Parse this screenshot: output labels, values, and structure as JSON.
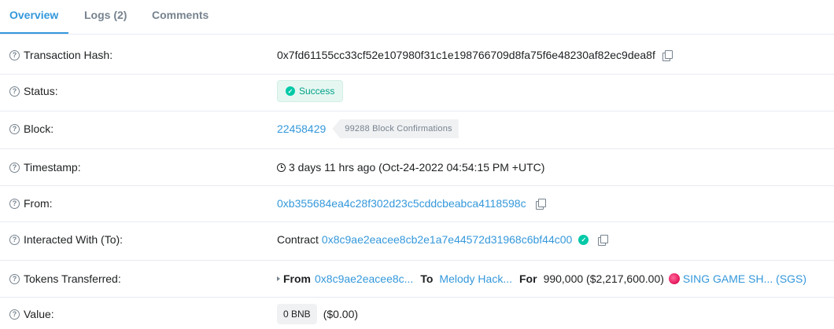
{
  "tabs": {
    "overview": "Overview",
    "logs": "Logs (2)",
    "comments": "Comments"
  },
  "help_glyph": "?",
  "rows": {
    "tx_hash": {
      "label": "Transaction Hash:",
      "value": "0x7fd61155cc33cf52e107980f31c1e198766709d8fa75f6e48230af82ec9dea8f"
    },
    "status": {
      "label": "Status:",
      "value": "Success"
    },
    "block": {
      "label": "Block:",
      "number": "22458429",
      "confirmations": "99288 Block Confirmations"
    },
    "timestamp": {
      "label": "Timestamp:",
      "value": "3 days 11 hrs ago (Oct-24-2022 04:54:15 PM +UTC)"
    },
    "from": {
      "label": "From:",
      "address": "0xb355684ea4c28f302d23c5cddcbeabca4118598c"
    },
    "interacted": {
      "label": "Interacted With (To):",
      "prefix": "Contract",
      "address": "0x8c9ae2eacee8cb2e1a7e44572d31968c6bf44c00"
    },
    "tokens": {
      "label": "Tokens Transferred:",
      "from_label": "From",
      "from_address": "0x8c9ae2eacee8c...",
      "to_label": "To",
      "to_name": "Melody Hack...",
      "for_label": "For",
      "amount": "990,000 ($2,217,600.00)",
      "token_name": "SING GAME SH... (SGS)"
    },
    "value": {
      "label": "Value:",
      "amount": "0 BNB",
      "usd": "($0.00)"
    }
  },
  "colors": {
    "link": "#3498db",
    "success": "#00c9a7",
    "muted": "#77838f"
  },
  "icons": [
    "help-icon",
    "copy-icon",
    "check-circle-icon",
    "clock-icon",
    "verified-icon",
    "caret-right-icon",
    "token-logo"
  ]
}
